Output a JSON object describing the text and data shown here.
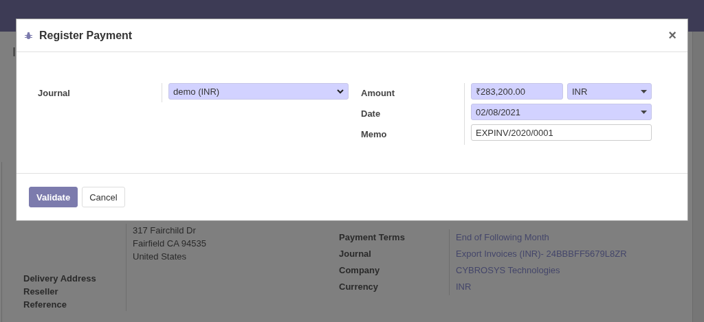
{
  "breadcrumb": "I",
  "invoice": {
    "address_lines": [
      "317 Fairchild Dr",
      "Fairfield CA 94535",
      "United States"
    ],
    "left_labels": [
      "Delivery Address",
      "Reseller",
      "Reference"
    ],
    "right_fields": [
      {
        "label": "Payment Terms",
        "value": "End of Following Month"
      },
      {
        "label": "Journal",
        "value": "Export Invoices (INR)- 24BBBFF5679L8ZR"
      },
      {
        "label": "Company",
        "value": "CYBROSYS Technologies"
      },
      {
        "label": "Currency",
        "value": "INR"
      }
    ]
  },
  "dialog": {
    "title": "Register Payment",
    "close": "×",
    "journal": {
      "label": "Journal",
      "value": "demo (INR)"
    },
    "amount": {
      "label": "Amount",
      "value": "₹283,200.00",
      "currency": "INR"
    },
    "date": {
      "label": "Date",
      "value": "02/08/2021"
    },
    "memo": {
      "label": "Memo",
      "value": "EXPINV/2020/0001"
    },
    "buttons": [
      {
        "label": "Validate",
        "kind": "primary"
      },
      {
        "label": "Cancel",
        "kind": "secondary"
      }
    ]
  }
}
